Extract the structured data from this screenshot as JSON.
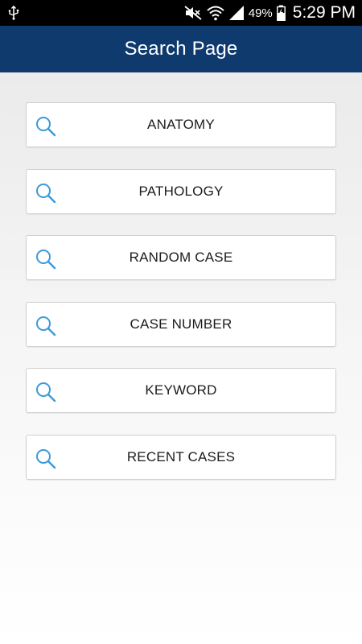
{
  "status_bar": {
    "battery_percent": "49%",
    "time": "5:29 PM",
    "icons": [
      "usb-icon",
      "mute-icon",
      "wifi-icon",
      "signal-icon",
      "battery-charging-icon"
    ]
  },
  "header": {
    "title": "Search Page",
    "background_color": "#0e3a6e"
  },
  "search_options": [
    {
      "label": "ANATOMY",
      "icon": "search-icon"
    },
    {
      "label": "PATHOLOGY",
      "icon": "search-icon"
    },
    {
      "label": "RANDOM CASE",
      "icon": "search-icon"
    },
    {
      "label": "CASE NUMBER",
      "icon": "search-icon"
    },
    {
      "label": "KEYWORD",
      "icon": "search-icon"
    },
    {
      "label": "RECENT CASES",
      "icon": "search-icon"
    }
  ],
  "colors": {
    "accent_icon": "#3a9ad9",
    "item_text": "#1c1c1c"
  }
}
